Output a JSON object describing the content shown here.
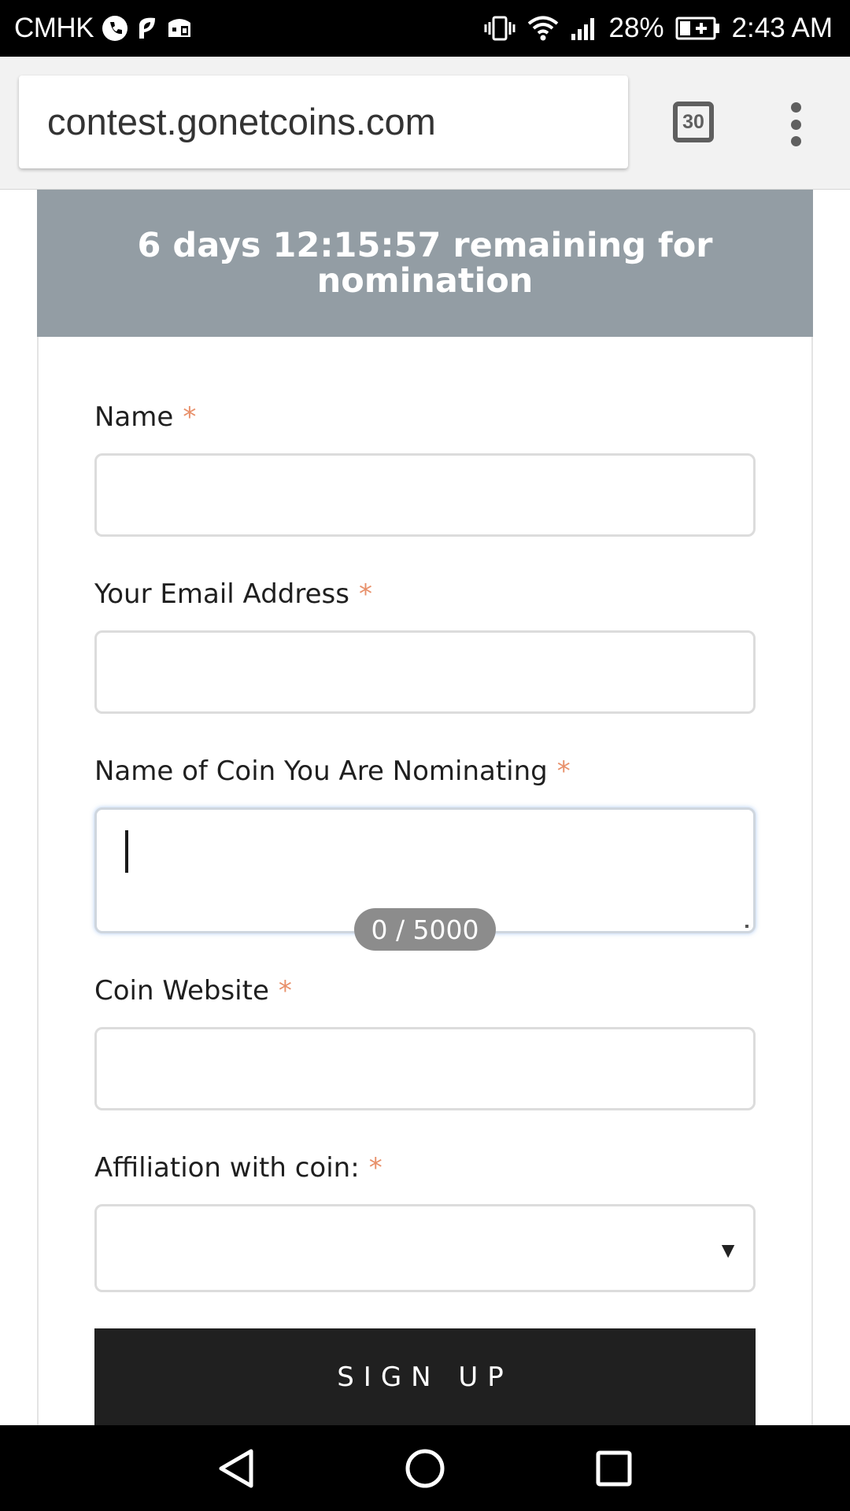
{
  "status_bar": {
    "carrier": "CMHK",
    "battery": "28%",
    "time": "2:43 AM",
    "icons": [
      "phone-icon",
      "leaf-icon",
      "game-icon",
      "vibrate-icon",
      "wifi-icon",
      "signal-icon",
      "battery-charging-icon"
    ]
  },
  "browser": {
    "url": "contest.gonetcoins.com",
    "tab_count": "30",
    "menu_icon": "more-vert-icon"
  },
  "banner": {
    "text": "6 days 12:15:57 remaining for nomination"
  },
  "form": {
    "required_mark": "*",
    "name_label": "Name",
    "name_value": "",
    "email_label": "Your Email Address",
    "email_value": "",
    "coin_label": "Name of Coin You Are Nominating",
    "coin_value": "",
    "coin_counter": "0 / 5000",
    "website_label": "Coin Website",
    "website_value": "",
    "affiliation_label": "Affiliation with coin:",
    "affiliation_value": "",
    "submit_label": "SIGN UP"
  },
  "nav": {
    "back_icon": "back-icon",
    "home_icon": "home-icon",
    "recents_icon": "recents-icon"
  }
}
